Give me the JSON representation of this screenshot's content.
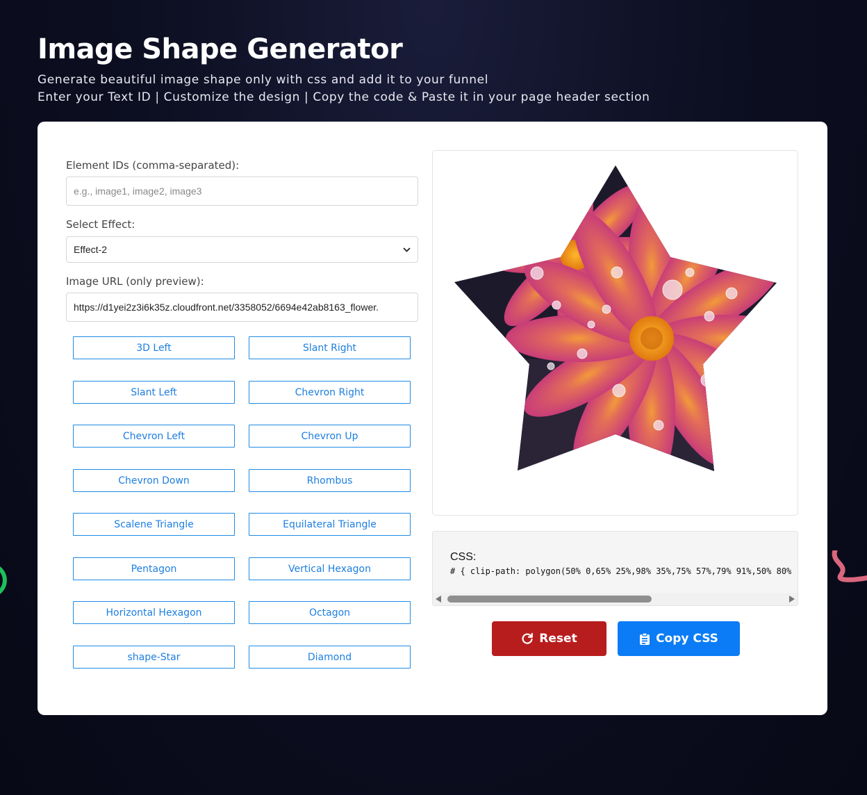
{
  "page": {
    "title": "Image Shape Generator",
    "subtitle_line1": "Generate beautiful image shape only with css and add it to your funnel",
    "subtitle_line2": "Enter your Text ID | Customize the design | Copy the code & Paste it in your page header section"
  },
  "form": {
    "element_ids": {
      "label": "Element IDs (comma-separated):",
      "placeholder": "e.g., image1, image2, image3",
      "value": ""
    },
    "effect": {
      "label": "Select Effect:",
      "value": "Effect-2"
    },
    "image_url": {
      "label": "Image URL (only preview):",
      "value": "https://d1yei2z3i6k35z.cloudfront.net/3358052/6694e42ab8163_flower."
    }
  },
  "shape_buttons": [
    "3D Left",
    "Slant Right",
    "Slant Left",
    "Chevron Right",
    "Chevron Left",
    "Chevron Up",
    "Chevron Down",
    "Rhombus",
    "Scalene Triangle",
    "Equilateral Triangle",
    "Pentagon",
    "Vertical Hexagon",
    "Horizontal Hexagon",
    "Octagon",
    "shape-Star",
    "Diamond"
  ],
  "preview": {
    "shape": "star",
    "image_subject": "pink-orange flower with water droplets"
  },
  "css_output": {
    "label": "CSS:",
    "code": "# { clip-path: polygon(50% 0,65% 25%,98% 35%,75% 57%,79% 91%,50% 80%"
  },
  "actions": {
    "reset_label": "Reset",
    "copy_label": "Copy CSS"
  },
  "colors": {
    "reset": "#b81d1d",
    "copy": "#0b7cf5",
    "shape_button_border": "#1d8be6",
    "background": "#0d0f22"
  },
  "icons": {
    "reset": "refresh-icon",
    "copy": "clipboard-icon"
  }
}
